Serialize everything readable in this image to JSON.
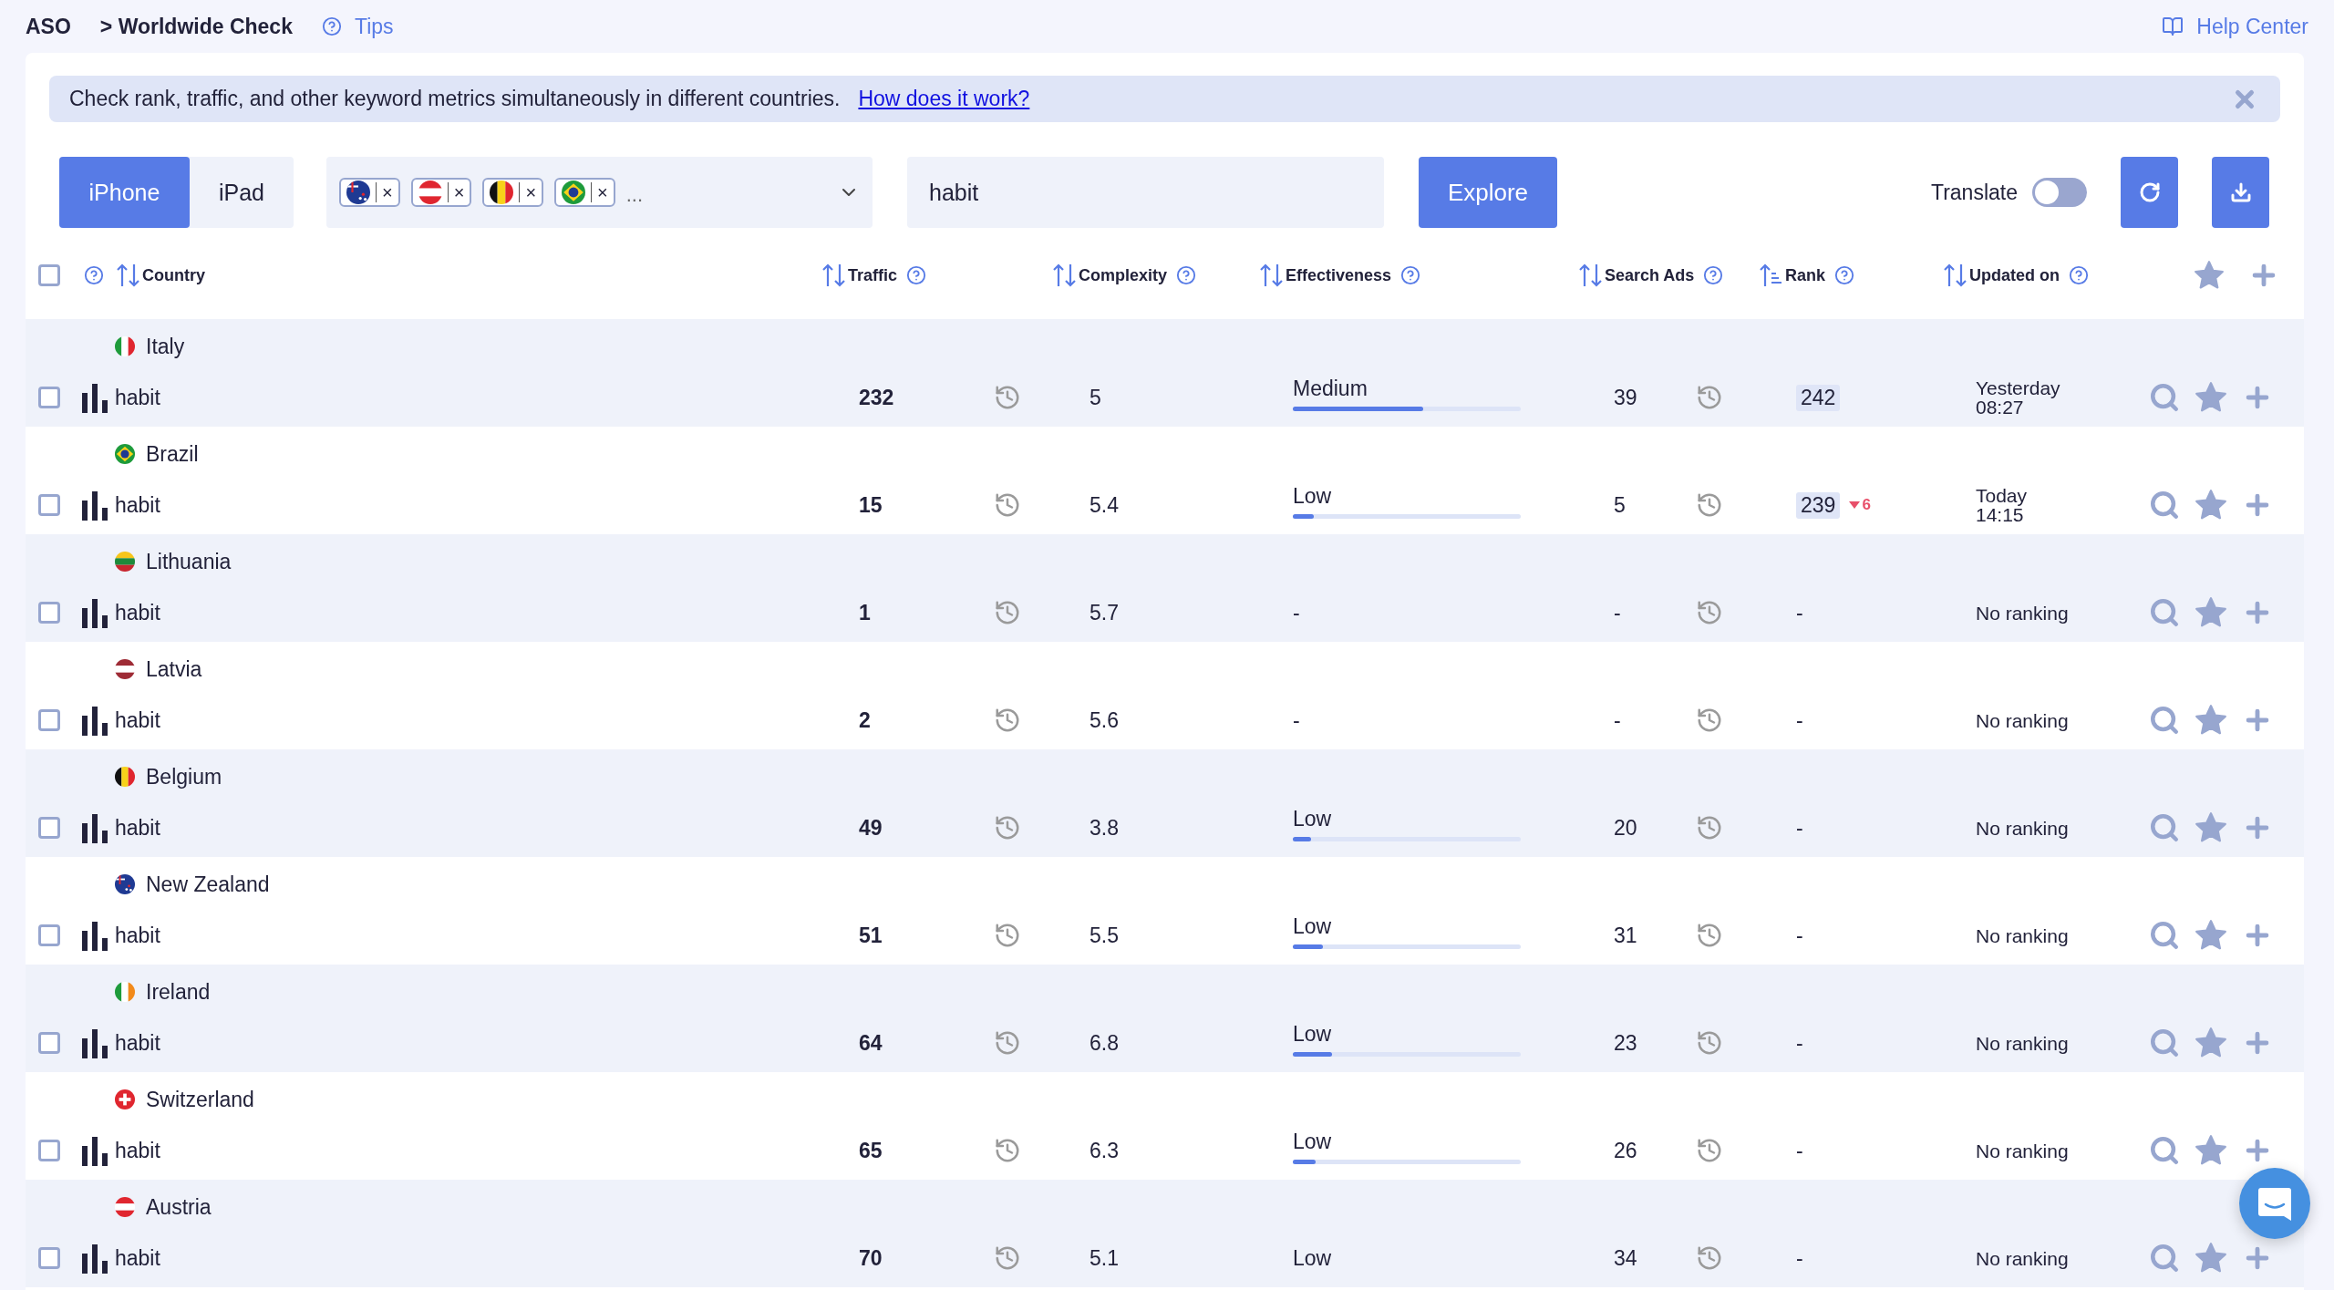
{
  "breadcrumb": {
    "root": "ASO",
    "current": "> Worldwide Check",
    "tips": "Tips"
  },
  "help_center": "Help Center",
  "banner": {
    "text": "Check rank, traffic, and other keyword metrics simultaneously in different countries.",
    "link": "How does it work?"
  },
  "devices": [
    {
      "label": "iPhone",
      "selected": true
    },
    {
      "label": "iPad",
      "selected": false
    }
  ],
  "country_chips": [
    {
      "remove": "×"
    },
    {
      "remove": "×"
    },
    {
      "remove": "×"
    },
    {
      "remove": "×"
    }
  ],
  "country_more": "...",
  "keyword_field": {
    "value": "habit"
  },
  "explore": "Explore",
  "translate": {
    "label": "Translate",
    "on": false
  },
  "header": {
    "checked": false,
    "columns": [
      {
        "label": "Country",
        "help": false
      },
      {
        "label": "Traffic",
        "help": true
      },
      {
        "label": "Complexity",
        "help": true
      },
      {
        "label": "Effectiveness",
        "help": true
      },
      {
        "label": "Search Ads",
        "help": true
      },
      {
        "label": "Rank",
        "help": true
      },
      {
        "label": "Updated on",
        "help": true
      }
    ]
  },
  "rows": [
    {
      "country": "Italy",
      "checked": false,
      "keyword": "habit",
      "traffic": "232",
      "complexity": "5",
      "effectiveness": "Medium",
      "level": 0.57,
      "search_ads": "39",
      "rank": "242",
      "rank_badge": true,
      "updated": "Yesterday\n08:27"
    },
    {
      "country": "Brazil",
      "checked": false,
      "keyword": "habit",
      "traffic": "15",
      "complexity": "5.4",
      "effectiveness": "Low",
      "level": 0.09,
      "search_ads": "5",
      "rank": "239",
      "rank_badge": true,
      "rank_change": "6",
      "updated": "Today\n14:15"
    },
    {
      "country": "Lithuania",
      "checked": false,
      "keyword": "habit",
      "traffic": "1",
      "complexity": "5.7",
      "effectiveness": "-",
      "search_ads": "-",
      "rank": "-",
      "rank_badge": false,
      "updated": "No ranking"
    },
    {
      "country": "Latvia",
      "checked": false,
      "keyword": "habit",
      "traffic": "2",
      "complexity": "5.6",
      "effectiveness": "-",
      "search_ads": "-",
      "rank": "-",
      "rank_badge": false,
      "updated": "No ranking"
    },
    {
      "country": "Belgium",
      "checked": false,
      "keyword": "habit",
      "traffic": "49",
      "complexity": "3.8",
      "effectiveness": "Low",
      "level": 0.08,
      "search_ads": "20",
      "rank": "-",
      "rank_badge": false,
      "updated": "No ranking"
    },
    {
      "country": "New Zealand",
      "checked": false,
      "keyword": "habit",
      "traffic": "51",
      "complexity": "5.5",
      "effectiveness": "Low",
      "level": 0.13,
      "search_ads": "31",
      "rank": "-",
      "rank_badge": false,
      "updated": "No ranking"
    },
    {
      "country": "Ireland",
      "checked": false,
      "keyword": "habit",
      "traffic": "64",
      "complexity": "6.8",
      "effectiveness": "Low",
      "level": 0.17,
      "search_ads": "23",
      "rank": "-",
      "rank_badge": false,
      "updated": "No ranking"
    },
    {
      "country": "Switzerland",
      "checked": false,
      "keyword": "habit",
      "traffic": "65",
      "complexity": "6.3",
      "effectiveness": "Low",
      "level": 0.1,
      "search_ads": "26",
      "rank": "-",
      "rank_badge": false,
      "updated": "No ranking"
    },
    {
      "country": "Austria",
      "checked": false,
      "keyword": "habit",
      "traffic": "70",
      "complexity": "5.1",
      "effectiveness": "Low",
      "search_ads": "34",
      "rank": "-",
      "rank_badge": false,
      "updated": "No ranking"
    }
  ]
}
